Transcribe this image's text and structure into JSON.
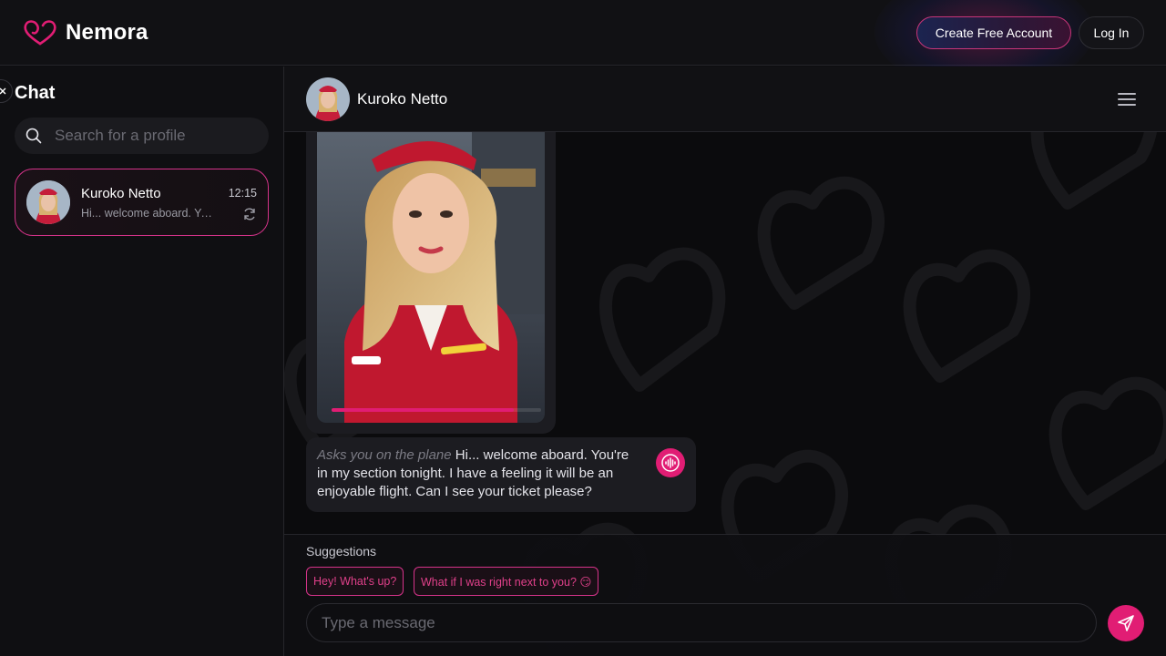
{
  "app": {
    "brand": "Nemora",
    "accent_color": "#e11d74"
  },
  "topbar": {
    "create_account_label": "Create Free Account",
    "login_label": "Log In"
  },
  "sidebar": {
    "title": "Chat",
    "search_placeholder": "Search for a profile",
    "conversations": [
      {
        "name": "Kuroko Netto",
        "preview": "Hi... welcome aboard. You're in my section tonight...",
        "time": "12:15",
        "active": true
      }
    ]
  },
  "chat": {
    "contact_name": "Kuroko Netto",
    "image_playback_progress": 0.87,
    "message": {
      "action": "Asks you on the plane",
      "text": "Hi... welcome aboard. You're in my section tonight. I have a feeling it will be an enjoyable flight. Can I see your ticket please?"
    },
    "suggestions_title": "Suggestions",
    "suggestions": [
      "Hey! What's up?",
      "What if I was right next to you? 😏"
    ],
    "input_placeholder": "Type a message"
  }
}
